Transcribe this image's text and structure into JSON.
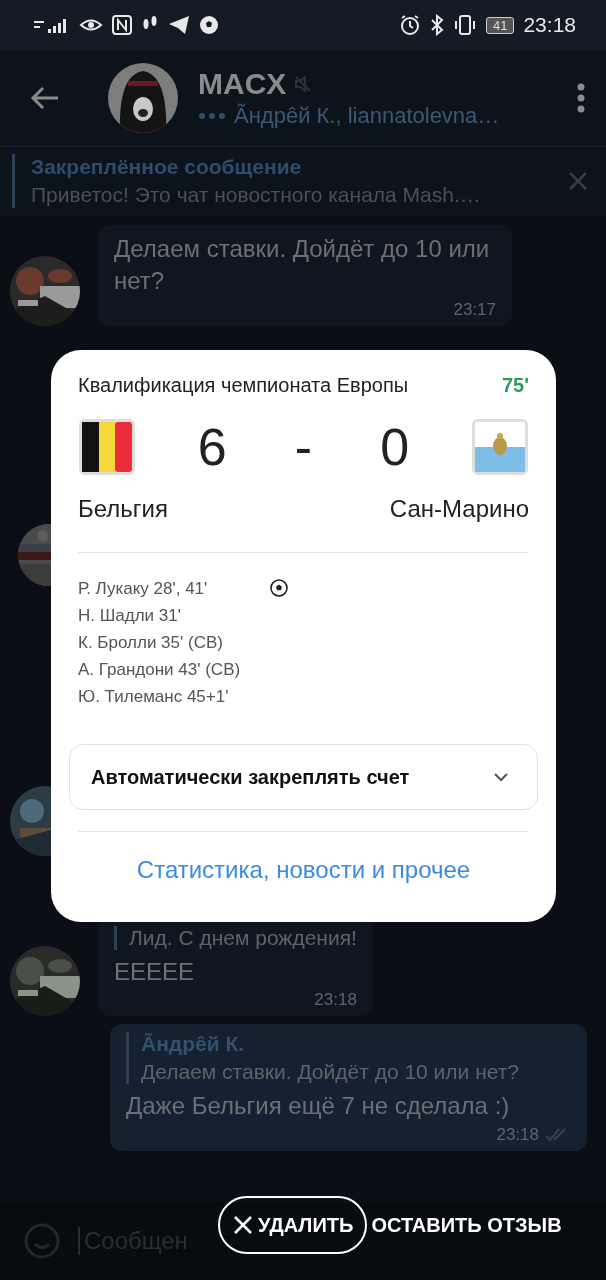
{
  "status_bar": {
    "battery": "41",
    "time": "23:18"
  },
  "header": {
    "title": "MACX",
    "muted": true,
    "subtitle": "Ãндрêй К., liannatolevna…"
  },
  "pinned": {
    "title": "Закреплённое сообщение",
    "text": "Приветос! Это чат новостного канала Mash.…"
  },
  "messages": [
    {
      "kind": "incoming",
      "text": "Делаем ставки. Дойдёт до 10 или нет?",
      "time": "23:17"
    },
    {
      "kind": "covered"
    },
    {
      "kind": "incoming",
      "reply_text": "Лид. С днем рождения!",
      "text": "ЕЕЕЕЕ",
      "time": "23:18"
    },
    {
      "kind": "outgoing",
      "reply_author": "Ãндрêй К.",
      "reply_text": "Делаем ставки. Дойдёт до 10 или нет?",
      "text": "Даже Бельгия ещё 7 не сделала :)",
      "time": "23:18",
      "read": true
    }
  ],
  "composer": {
    "placeholder": "Сообщен"
  },
  "match_card": {
    "tournament": "Квалификация чемпионата Европы",
    "minute": "75'",
    "home": {
      "name": "Бельгия",
      "score": "6"
    },
    "separator": "-",
    "away": {
      "name": "Сан-Марино",
      "score": "0"
    },
    "scorers": [
      "Р. Лукаку 28', 41'",
      "Н. Шадли 31'",
      "К. Бролли 35' (СВ)",
      "А. Грандони 43' (СВ)",
      "Ю. Тилеманс 45+1'"
    ],
    "auto_pin": {
      "label": "Автоматически закреплять счет",
      "expanded": false
    },
    "link": "Статистика, новости и прочее"
  },
  "toast": {
    "dismiss": "УДАЛИТЬ",
    "action": "ОСТАВИТЬ ОТЗЫВ"
  }
}
